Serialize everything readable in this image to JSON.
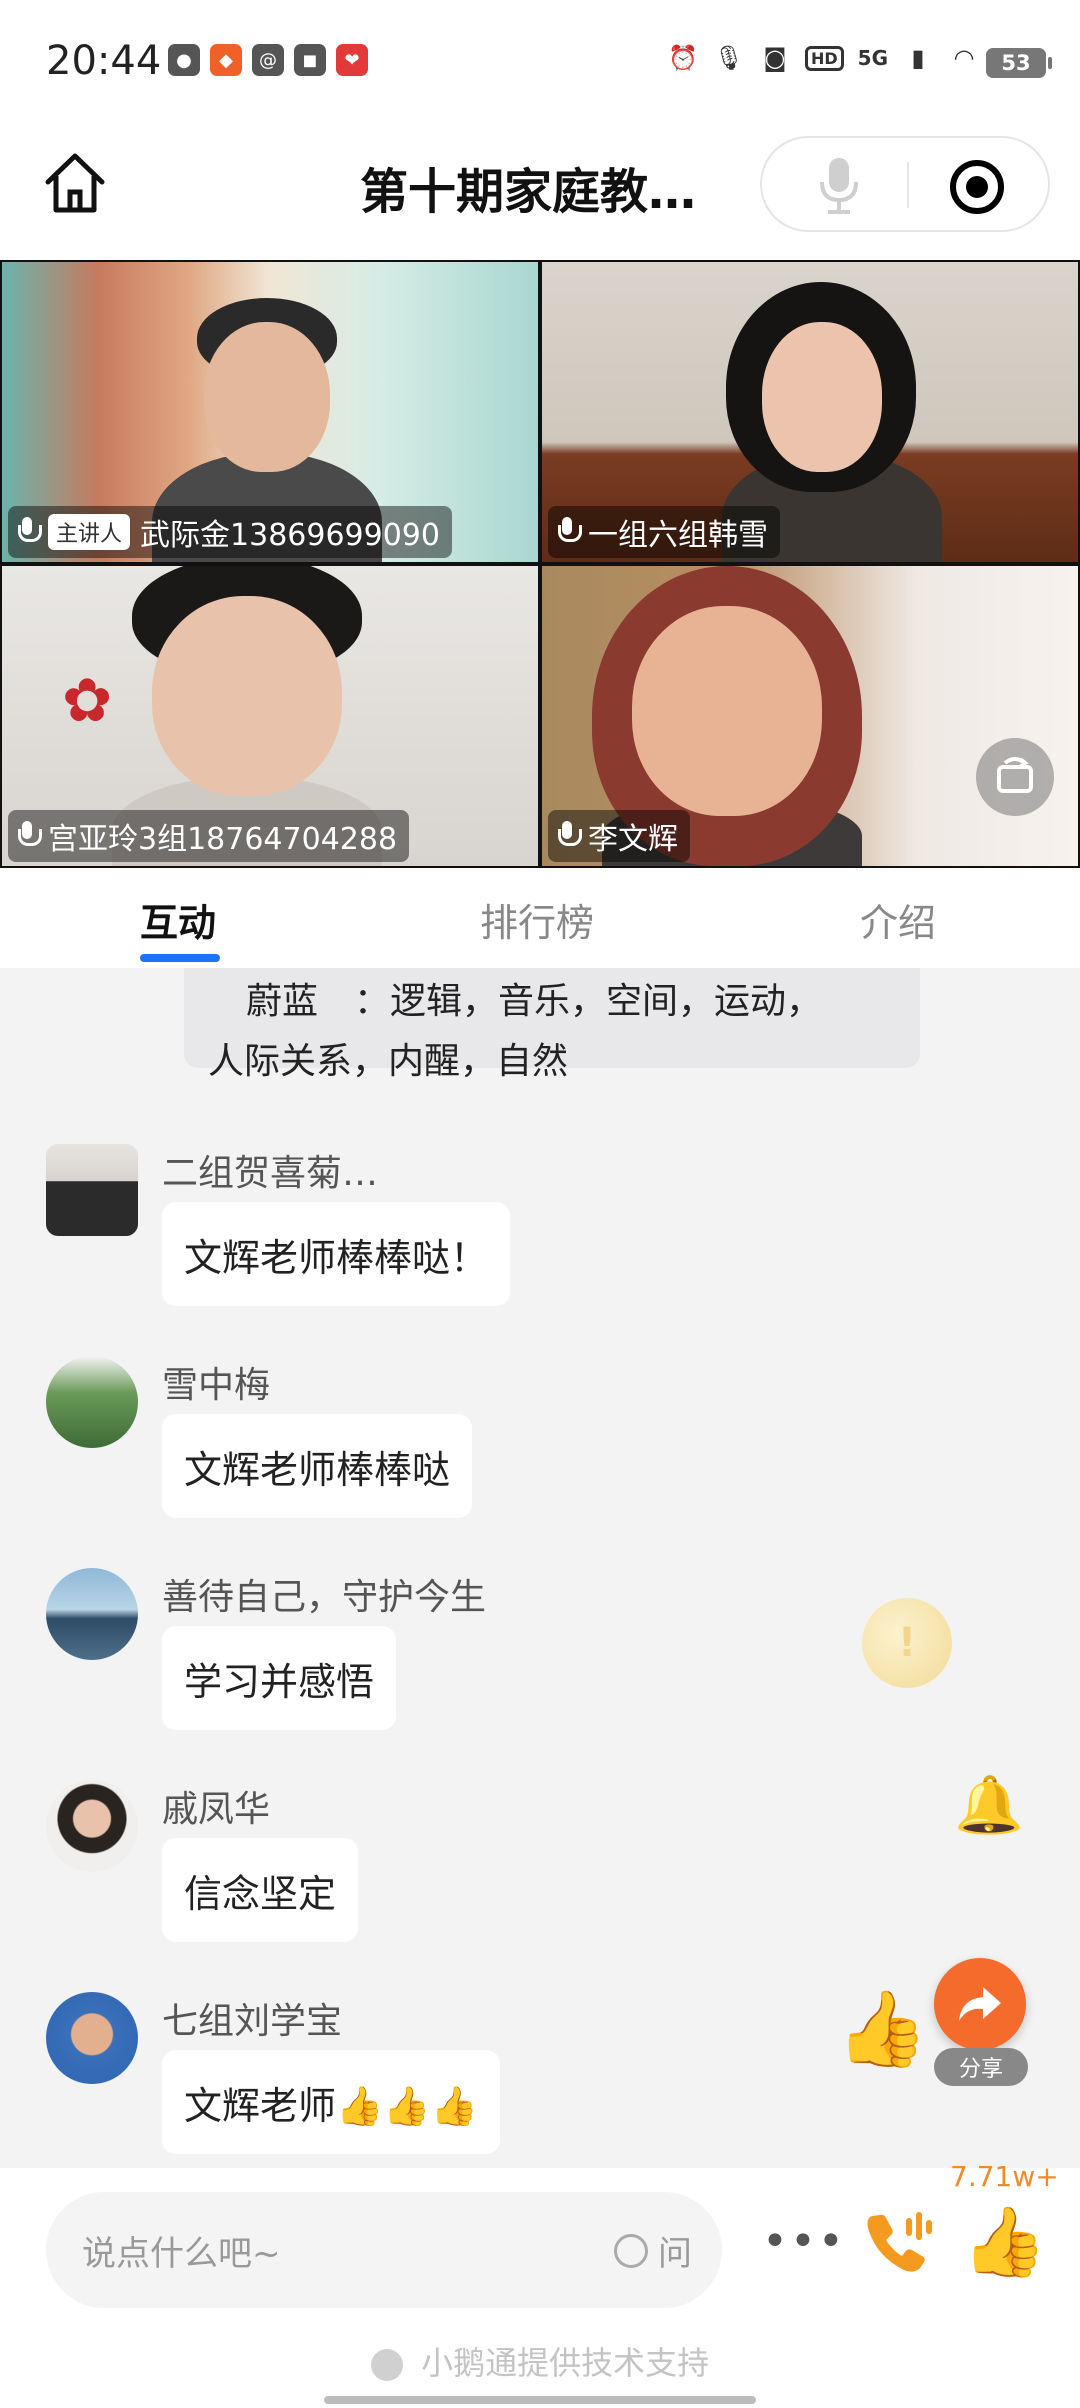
{
  "status_bar": {
    "time": "20:44",
    "network": "5G",
    "hd": "HD",
    "battery": "53"
  },
  "header": {
    "title": "第十期家庭教…"
  },
  "video": {
    "tiles": [
      {
        "name": "武际金13869699090",
        "badge": "主讲人"
      },
      {
        "name": "一组六组韩雪"
      },
      {
        "name": "宫亚玲3组18764704288"
      },
      {
        "name": "李文辉"
      }
    ]
  },
  "tabs": [
    {
      "label": "互动",
      "active": true
    },
    {
      "label": "排行榜",
      "active": false
    },
    {
      "label": "介绍",
      "active": false
    }
  ],
  "chat": {
    "system_message_line1": "蔚蓝　：逻辑，音乐，空间，运动，",
    "system_message_line2": "人际关系，内醒，自然",
    "messages": [
      {
        "sender": "二组贺喜菊…",
        "text": "文辉老师棒棒哒！"
      },
      {
        "sender": "雪中梅",
        "text": "文辉老师棒棒哒"
      },
      {
        "sender": "善待自己，守护今生",
        "text": "学习并感悟"
      },
      {
        "sender": "戚凤华",
        "text": "信念坚定"
      },
      {
        "sender": "七组刘学宝",
        "text": "文辉老师👍👍👍"
      }
    ]
  },
  "share": {
    "label": "分享"
  },
  "bottom": {
    "placeholder": "说点什么吧~",
    "ask_label": "问",
    "likes": "7.71w+",
    "credit": "小鹅通提供技术支持"
  },
  "colors": {
    "accent": "#1f72ff",
    "share": "#f46b2c",
    "phone": "#f39a1f"
  },
  "icons": [
    "home-icon",
    "mic-icon",
    "record-icon",
    "rotate-camera-icon",
    "share-icon",
    "more-icon",
    "phone-icon",
    "like-icon",
    "bell-icon",
    "coin-icon"
  ]
}
